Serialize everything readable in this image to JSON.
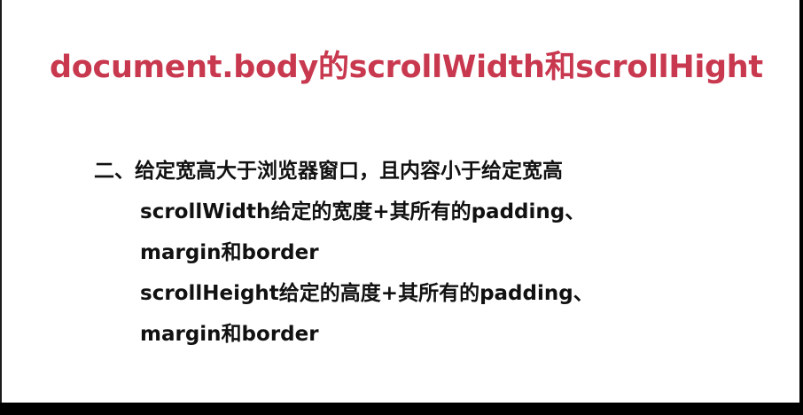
{
  "slide": {
    "title": "document.body的scrollWidth和scrollHight",
    "lines": [
      "二、给定宽高大于浏览器窗口，且内容小于给定宽高",
      "scrollWidth给定的宽度+其所有的padding、",
      "margin和border",
      "scrollHeight给定的高度+其所有的padding、",
      "margin和border"
    ]
  },
  "colors": {
    "title": "#c8384e",
    "text": "#111111",
    "background": "#ffffff",
    "frame": "#000000"
  }
}
